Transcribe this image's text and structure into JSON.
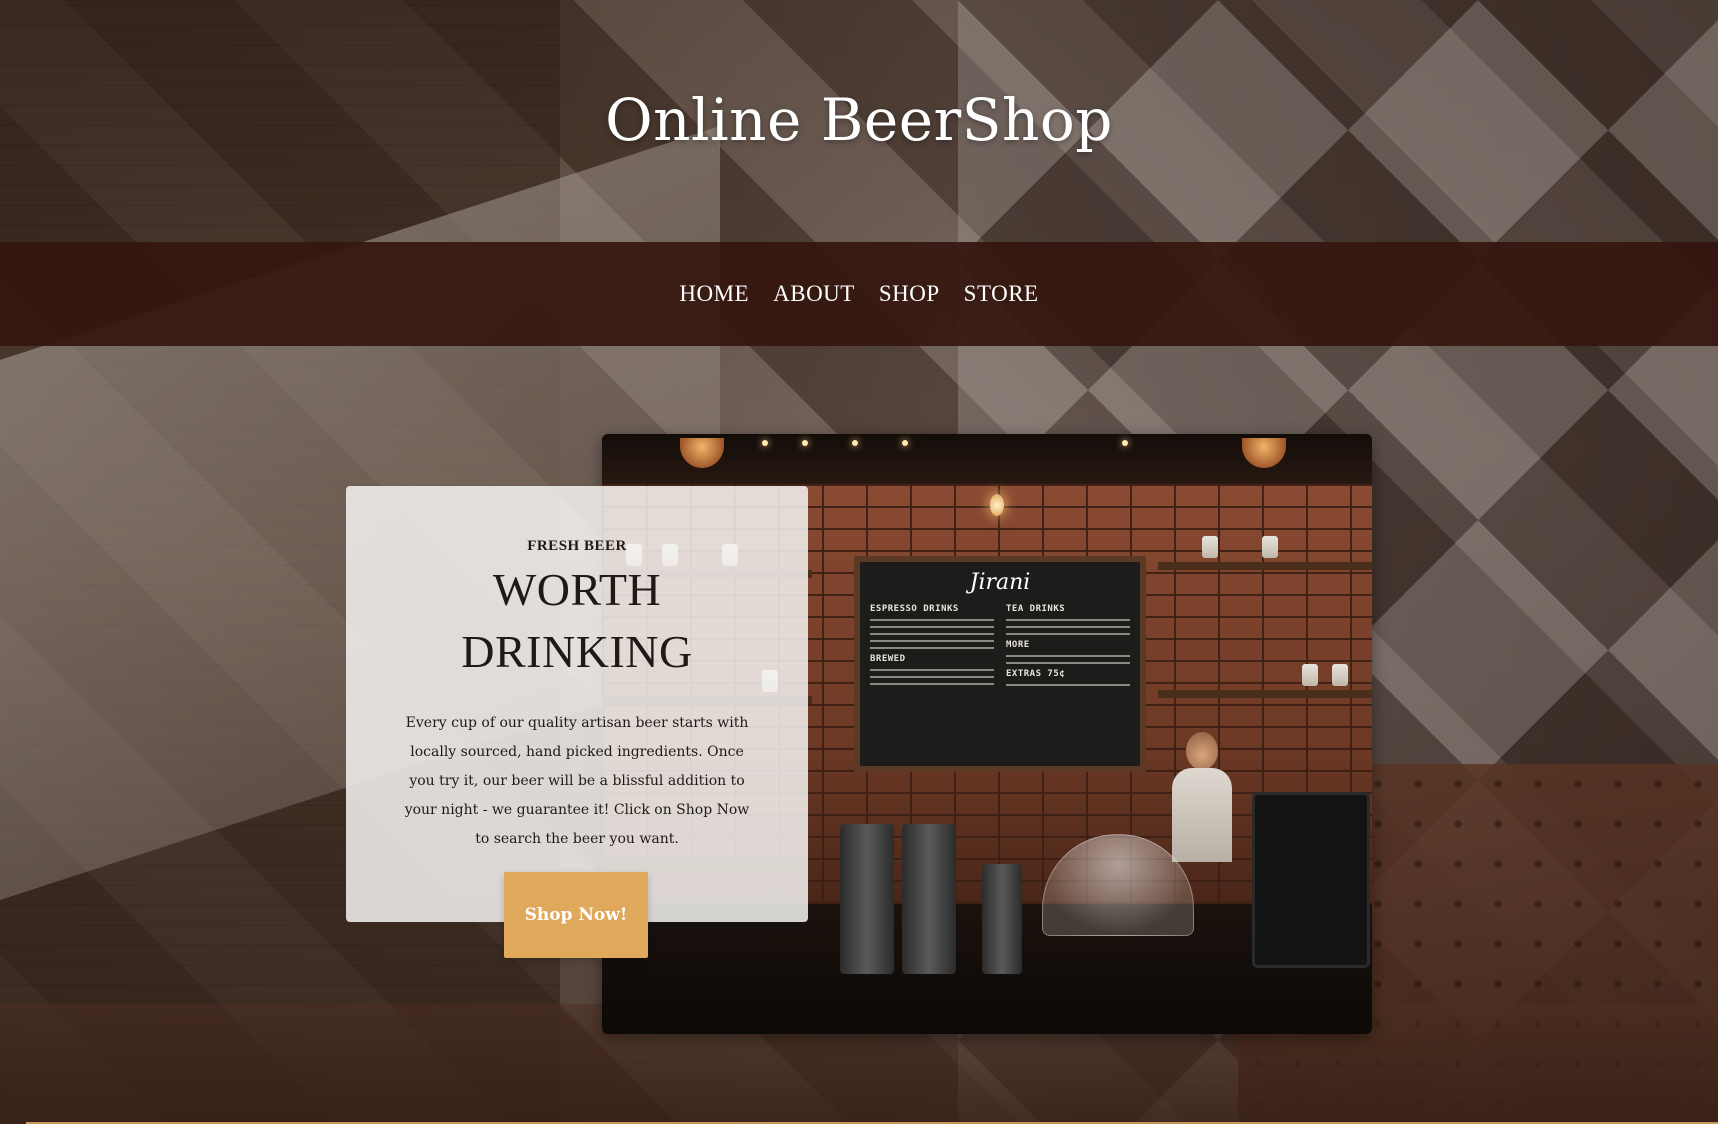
{
  "header": {
    "site_title": "Online BeerShop"
  },
  "nav": {
    "items": [
      {
        "label": "HOME"
      },
      {
        "label": "ABOUT"
      },
      {
        "label": "SHOP"
      },
      {
        "label": "STORE"
      }
    ]
  },
  "intro": {
    "eyebrow": "FRESH BEER",
    "heading": "WORTH DRINKING",
    "text": "Every cup of our quality artisan beer starts with locally sourced, hand picked ingredients. Once you try it, our beer will be a blissful addition to your night - we guarantee it! Click on Shop Now to search the beer you want.",
    "button_label": "Shop Now!"
  },
  "photo": {
    "menu_board_title": "Jirani",
    "menu_sections": [
      "ESPRESSO DRINKS",
      "TEA DRINKS",
      "MORE",
      "BREWED",
      "EXTRAS 75¢"
    ]
  },
  "colors": {
    "navbar": "#34160e",
    "button": "#e0a85a",
    "card": "#f5f3f1",
    "text": "#1f1a17"
  }
}
